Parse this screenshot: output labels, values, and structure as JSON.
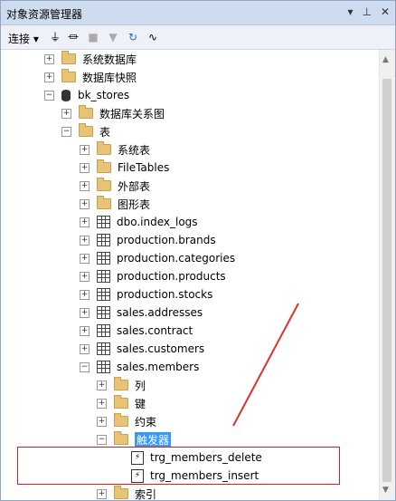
{
  "window": {
    "title": "对象资源管理器",
    "pin_glyph": "▾ ꟷ ✕"
  },
  "toolbar": {
    "connect_label": "连接 ▾"
  },
  "tree": {
    "nodes": [
      {
        "label": "系统数据库",
        "type": "folder",
        "exp": "+",
        "indent": 0
      },
      {
        "label": "数据库快照",
        "type": "folder",
        "exp": "+",
        "indent": 0
      },
      {
        "label": "bk_stores",
        "type": "db",
        "exp": "−",
        "indent": 0
      },
      {
        "label": "数据库关系图",
        "type": "folder",
        "exp": "+",
        "indent": 1
      },
      {
        "label": "表",
        "type": "folder",
        "exp": "−",
        "indent": 1
      },
      {
        "label": "系统表",
        "type": "folder",
        "exp": "+",
        "indent": 2
      },
      {
        "label": "FileTables",
        "type": "folder",
        "exp": "+",
        "indent": 2
      },
      {
        "label": "外部表",
        "type": "folder",
        "exp": "+",
        "indent": 2
      },
      {
        "label": "图形表",
        "type": "folder",
        "exp": "+",
        "indent": 2
      },
      {
        "label": "dbo.index_logs",
        "type": "table",
        "exp": "+",
        "indent": 2
      },
      {
        "label": "production.brands",
        "type": "table",
        "exp": "+",
        "indent": 2
      },
      {
        "label": "production.categories",
        "type": "table",
        "exp": "+",
        "indent": 2
      },
      {
        "label": "production.products",
        "type": "table",
        "exp": "+",
        "indent": 2
      },
      {
        "label": "production.stocks",
        "type": "table",
        "exp": "+",
        "indent": 2
      },
      {
        "label": "sales.addresses",
        "type": "table",
        "exp": "+",
        "indent": 2
      },
      {
        "label": "sales.contract",
        "type": "table",
        "exp": "+",
        "indent": 2
      },
      {
        "label": "sales.customers",
        "type": "table",
        "exp": "+",
        "indent": 2
      },
      {
        "label": "sales.members",
        "type": "table",
        "exp": "−",
        "indent": 2
      },
      {
        "label": "列",
        "type": "folder",
        "exp": "+",
        "indent": 3
      },
      {
        "label": "键",
        "type": "folder",
        "exp": "+",
        "indent": 3
      },
      {
        "label": "约束",
        "type": "folder",
        "exp": "+",
        "indent": 3
      },
      {
        "label": "触发器",
        "type": "folder",
        "exp": "−",
        "indent": 3,
        "selected": true
      },
      {
        "label": "trg_members_delete",
        "type": "trigger",
        "exp": "",
        "indent": 4
      },
      {
        "label": "trg_members_insert",
        "type": "trigger",
        "exp": "",
        "indent": 4
      },
      {
        "label": "索引",
        "type": "folder",
        "exp": "+",
        "indent": 3
      }
    ]
  },
  "colors": {
    "accent": "#3399ff",
    "highlight_box": "#d62020"
  }
}
